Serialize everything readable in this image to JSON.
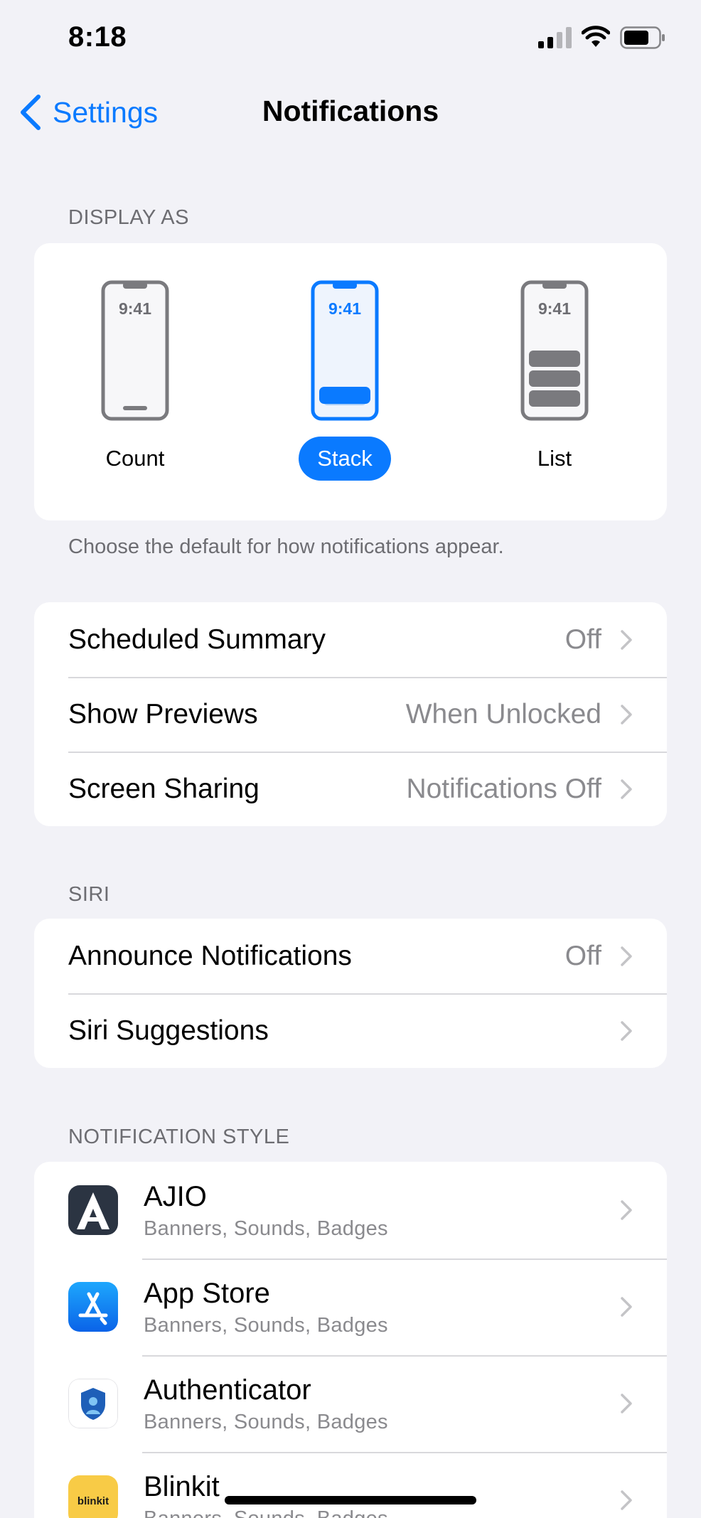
{
  "status_bar": {
    "time": "8:18",
    "icons": [
      "cellular-signal-icon",
      "wifi-icon",
      "battery-icon"
    ]
  },
  "nav": {
    "back_label": "Settings",
    "title": "Notifications"
  },
  "display_as": {
    "header": "DISPLAY AS",
    "phone_time": "9:41",
    "options": [
      {
        "label": "Count",
        "selected": false
      },
      {
        "label": "Stack",
        "selected": true
      },
      {
        "label": "List",
        "selected": false
      }
    ],
    "footer": "Choose the default for how notifications appear."
  },
  "general_rows": [
    {
      "label": "Scheduled Summary",
      "value": "Off"
    },
    {
      "label": "Show Previews",
      "value": "When Unlocked"
    },
    {
      "label": "Screen Sharing",
      "value": "Notifications Off"
    }
  ],
  "siri": {
    "header": "SIRI",
    "rows": [
      {
        "label": "Announce Notifications",
        "value": "Off"
      },
      {
        "label": "Siri Suggestions",
        "value": ""
      }
    ]
  },
  "notification_style": {
    "header": "NOTIFICATION STYLE",
    "apps": [
      {
        "name": "AJIO",
        "detail": "Banners, Sounds, Badges",
        "icon": "ajio-app-icon"
      },
      {
        "name": "App Store",
        "detail": "Banners, Sounds, Badges",
        "icon": "app-store-app-icon"
      },
      {
        "name": "Authenticator",
        "detail": "Banners, Sounds, Badges",
        "icon": "authenticator-app-icon"
      },
      {
        "name": "Blinkit",
        "detail": "Banners, Sounds, Badges",
        "icon": "blinkit-app-icon",
        "icon_text": "blinkit"
      }
    ]
  },
  "colors": {
    "accent": "#0a7aff",
    "background": "#f2f2f7",
    "secondary_text": "#8a8a8e"
  }
}
